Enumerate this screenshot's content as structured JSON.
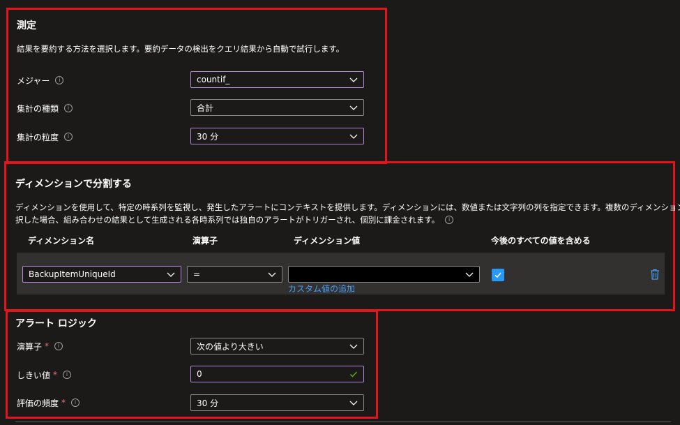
{
  "measure": {
    "title": "測定",
    "description": "結果を要約する方法を選択します。要約データの検出をクエリ結果から自動で試行します。",
    "measure_label": "メジャー",
    "measure_value": "countif_",
    "aggregation_type_label": "集計の種類",
    "aggregation_type_value": "合計",
    "aggregation_granularity_label": "集計の粒度",
    "aggregation_granularity_value": "30 分"
  },
  "split": {
    "title": "ディメンションで分割する",
    "description_line1": "ディメンションを使用して、特定の時系列を監視し、発生したアラートにコンテキストを提供します。ディメンションには、数値または文字列の列を指定できます。複数のディメンション値を選",
    "description_line2": "択した場合、組み合わせの結果として生成される各時系列では独自のアラートがトリガーされ、個別に課金されます。",
    "columns": [
      "ディメンション名",
      "演算子",
      "ディメンション値",
      "今後のすべての値を含める"
    ],
    "row": {
      "dimension_name": "BackupItemUniqueId",
      "operator": "=",
      "dimension_value": "",
      "add_custom_value": "カスタム値の追加"
    }
  },
  "alert_logic": {
    "title": "アラート ロジック",
    "operator_label": "演算子",
    "operator_value": "次の値より大きい",
    "threshold_label": "しきい値",
    "threshold_value": "0",
    "frequency_label": "評価の頻度",
    "frequency_value": "30 分",
    "required_mark": "*"
  },
  "icons": {
    "info": "info-icon",
    "chevron": "chevron-down-icon",
    "check": "checkmark-icon",
    "delete": "trash-icon"
  },
  "colors": {
    "highlight_border": "#e3141b",
    "focus_border": "#b388d9",
    "accent": "#2899f5",
    "link": "#479ef5"
  }
}
